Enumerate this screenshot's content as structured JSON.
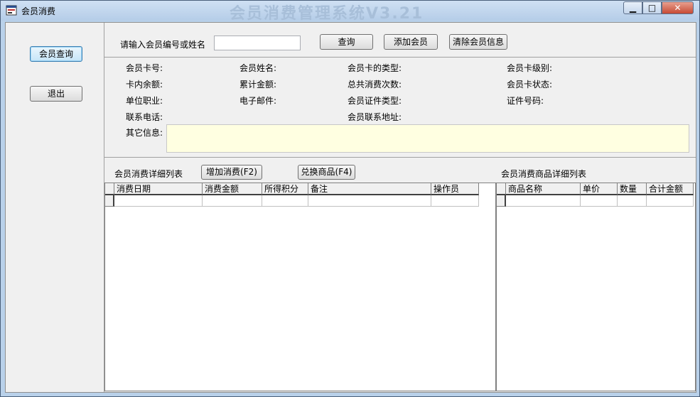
{
  "window": {
    "title": "会员消费",
    "watermark": "会员消费管理系统V3.21",
    "min_glyph": "▁",
    "max_glyph": "□",
    "close_glyph": "✕"
  },
  "sidebar": {
    "query_label": "会员查询",
    "exit_label": "退出"
  },
  "search": {
    "prompt": "请输入会员编号或姓名",
    "value": "",
    "query_button": "查询",
    "add_member_button": "添加会员",
    "clear_button": "清除会员信息"
  },
  "info": {
    "card_no": "会员卡号:",
    "name": "会员姓名:",
    "card_type": "会员卡的类型:",
    "card_level": "会员卡级别:",
    "balance": "卡内余额:",
    "total_amount": "累计金额:",
    "total_count": "总共消费次数:",
    "card_status": "会员卡状态:",
    "job": "单位职业:",
    "email": "电子邮件:",
    "id_type": "会员证件类型:",
    "id_no": "证件号码:",
    "phone": "联系电话:",
    "address": "会员联系地址:",
    "other": "其它信息:"
  },
  "consumption": {
    "title": "会员消费详细列表",
    "add_button": "增加消费(F2)",
    "exchange_button": "兑换商品(F4)",
    "columns": [
      "消费日期",
      "消费金额",
      "所得积分",
      "备注",
      "操作员"
    ]
  },
  "goods": {
    "title": "会员消费商品详细列表",
    "columns": [
      "商品名称",
      "单价",
      "数量",
      "合计金额"
    ]
  },
  "icons": {
    "app": "app-window-icon"
  }
}
